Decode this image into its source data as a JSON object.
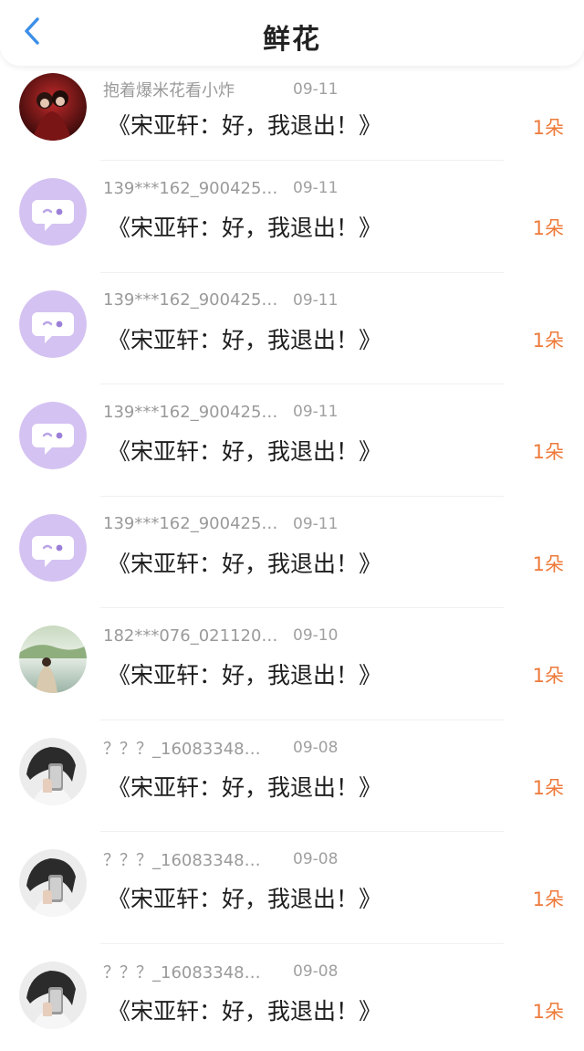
{
  "header": {
    "title": "鲜花",
    "back_icon": "chevron-left-icon",
    "accent": "#3d8fe8"
  },
  "colors": {
    "amount": "#ee7a3a",
    "avatar_bubble_bg": "#d4c2f2"
  },
  "items": [
    {
      "avatar": "photo-couple-red",
      "user": "抱着爆米花看小炸",
      "date": "09-11",
      "message": "《宋亚轩：好，我退出！》",
      "amount": "1朵"
    },
    {
      "avatar": "chat-bubble-icon",
      "user": "139***162_900425…",
      "date": "09-11",
      "message": "《宋亚轩：好，我退出！》",
      "amount": "1朵"
    },
    {
      "avatar": "chat-bubble-icon",
      "user": "139***162_900425…",
      "date": "09-11",
      "message": "《宋亚轩：好，我退出！》",
      "amount": "1朵"
    },
    {
      "avatar": "chat-bubble-icon",
      "user": "139***162_900425…",
      "date": "09-11",
      "message": "《宋亚轩：好，我退出！》",
      "amount": "1朵"
    },
    {
      "avatar": "chat-bubble-icon",
      "user": "139***162_900425…",
      "date": "09-11",
      "message": "《宋亚轩：好，我退出！》",
      "amount": "1朵"
    },
    {
      "avatar": "photo-landscape-girl",
      "user": "182***076_021120…",
      "date": "09-10",
      "message": "《宋亚轩：好，我退出！》",
      "amount": "1朵"
    },
    {
      "avatar": "photo-mirror-selfie",
      "user": "？？？_16083348…",
      "date": "09-08",
      "message": "《宋亚轩：好，我退出！》",
      "amount": "1朵"
    },
    {
      "avatar": "photo-mirror-selfie",
      "user": "？？？_16083348…",
      "date": "09-08",
      "message": "《宋亚轩：好，我退出！》",
      "amount": "1朵"
    },
    {
      "avatar": "photo-mirror-selfie",
      "user": "？？？_16083348…",
      "date": "09-08",
      "message": "《宋亚轩：好，我退出！》",
      "amount": "1朵"
    }
  ]
}
